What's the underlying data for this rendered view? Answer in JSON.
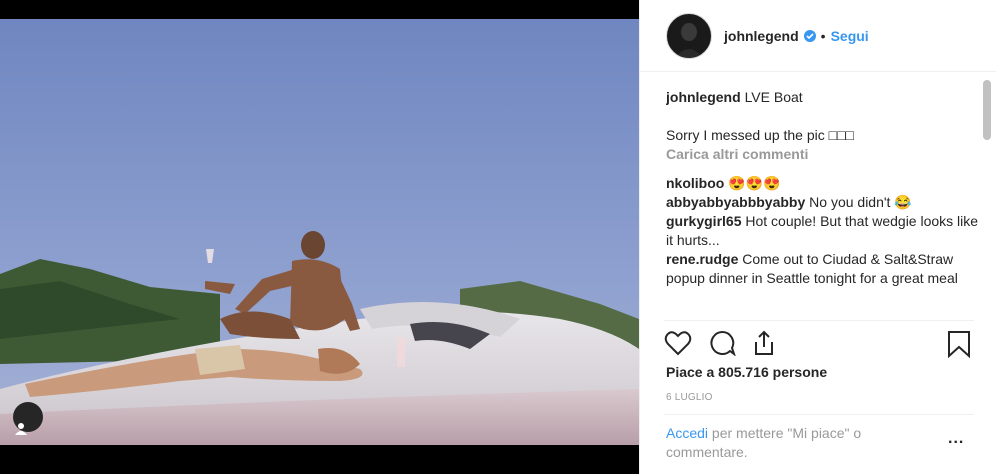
{
  "post": {
    "username": "johnlegend",
    "follow_label": "Segui",
    "separator": "•",
    "caption_user": "johnlegend",
    "caption_text": "LVE Boat",
    "caption_extra": "Sorry I messed up the pic □□□",
    "load_more": "Carica altri commenti",
    "comments": [
      {
        "user": "nkoliboo",
        "text": "😍😍😍"
      },
      {
        "user": "abbyabbyabbbyabby",
        "text": "No you didn't 😂"
      },
      {
        "user": "gurkygirl65",
        "text": "Hot couple! But that wedgie looks like it hurts..."
      },
      {
        "user": "rene.rudge",
        "text": "Come out to Ciudad & Salt&Straw popup dinner in Seattle tonight for a great meal"
      }
    ],
    "likes": "Piace a 805.716 persone",
    "date": "6 LUGLIO",
    "login_link": "Accedi",
    "login_text": "per mettere \"Mi piace\" o commentare.",
    "more_label": "..."
  },
  "icons": {
    "like": "heart-icon",
    "comment": "comment-icon",
    "share": "share-icon",
    "save": "bookmark-icon",
    "verified": "verified-badge-icon",
    "tag": "user-tag-icon"
  },
  "colors": {
    "accent": "#3897f0",
    "text": "#262626",
    "muted": "#999999"
  }
}
